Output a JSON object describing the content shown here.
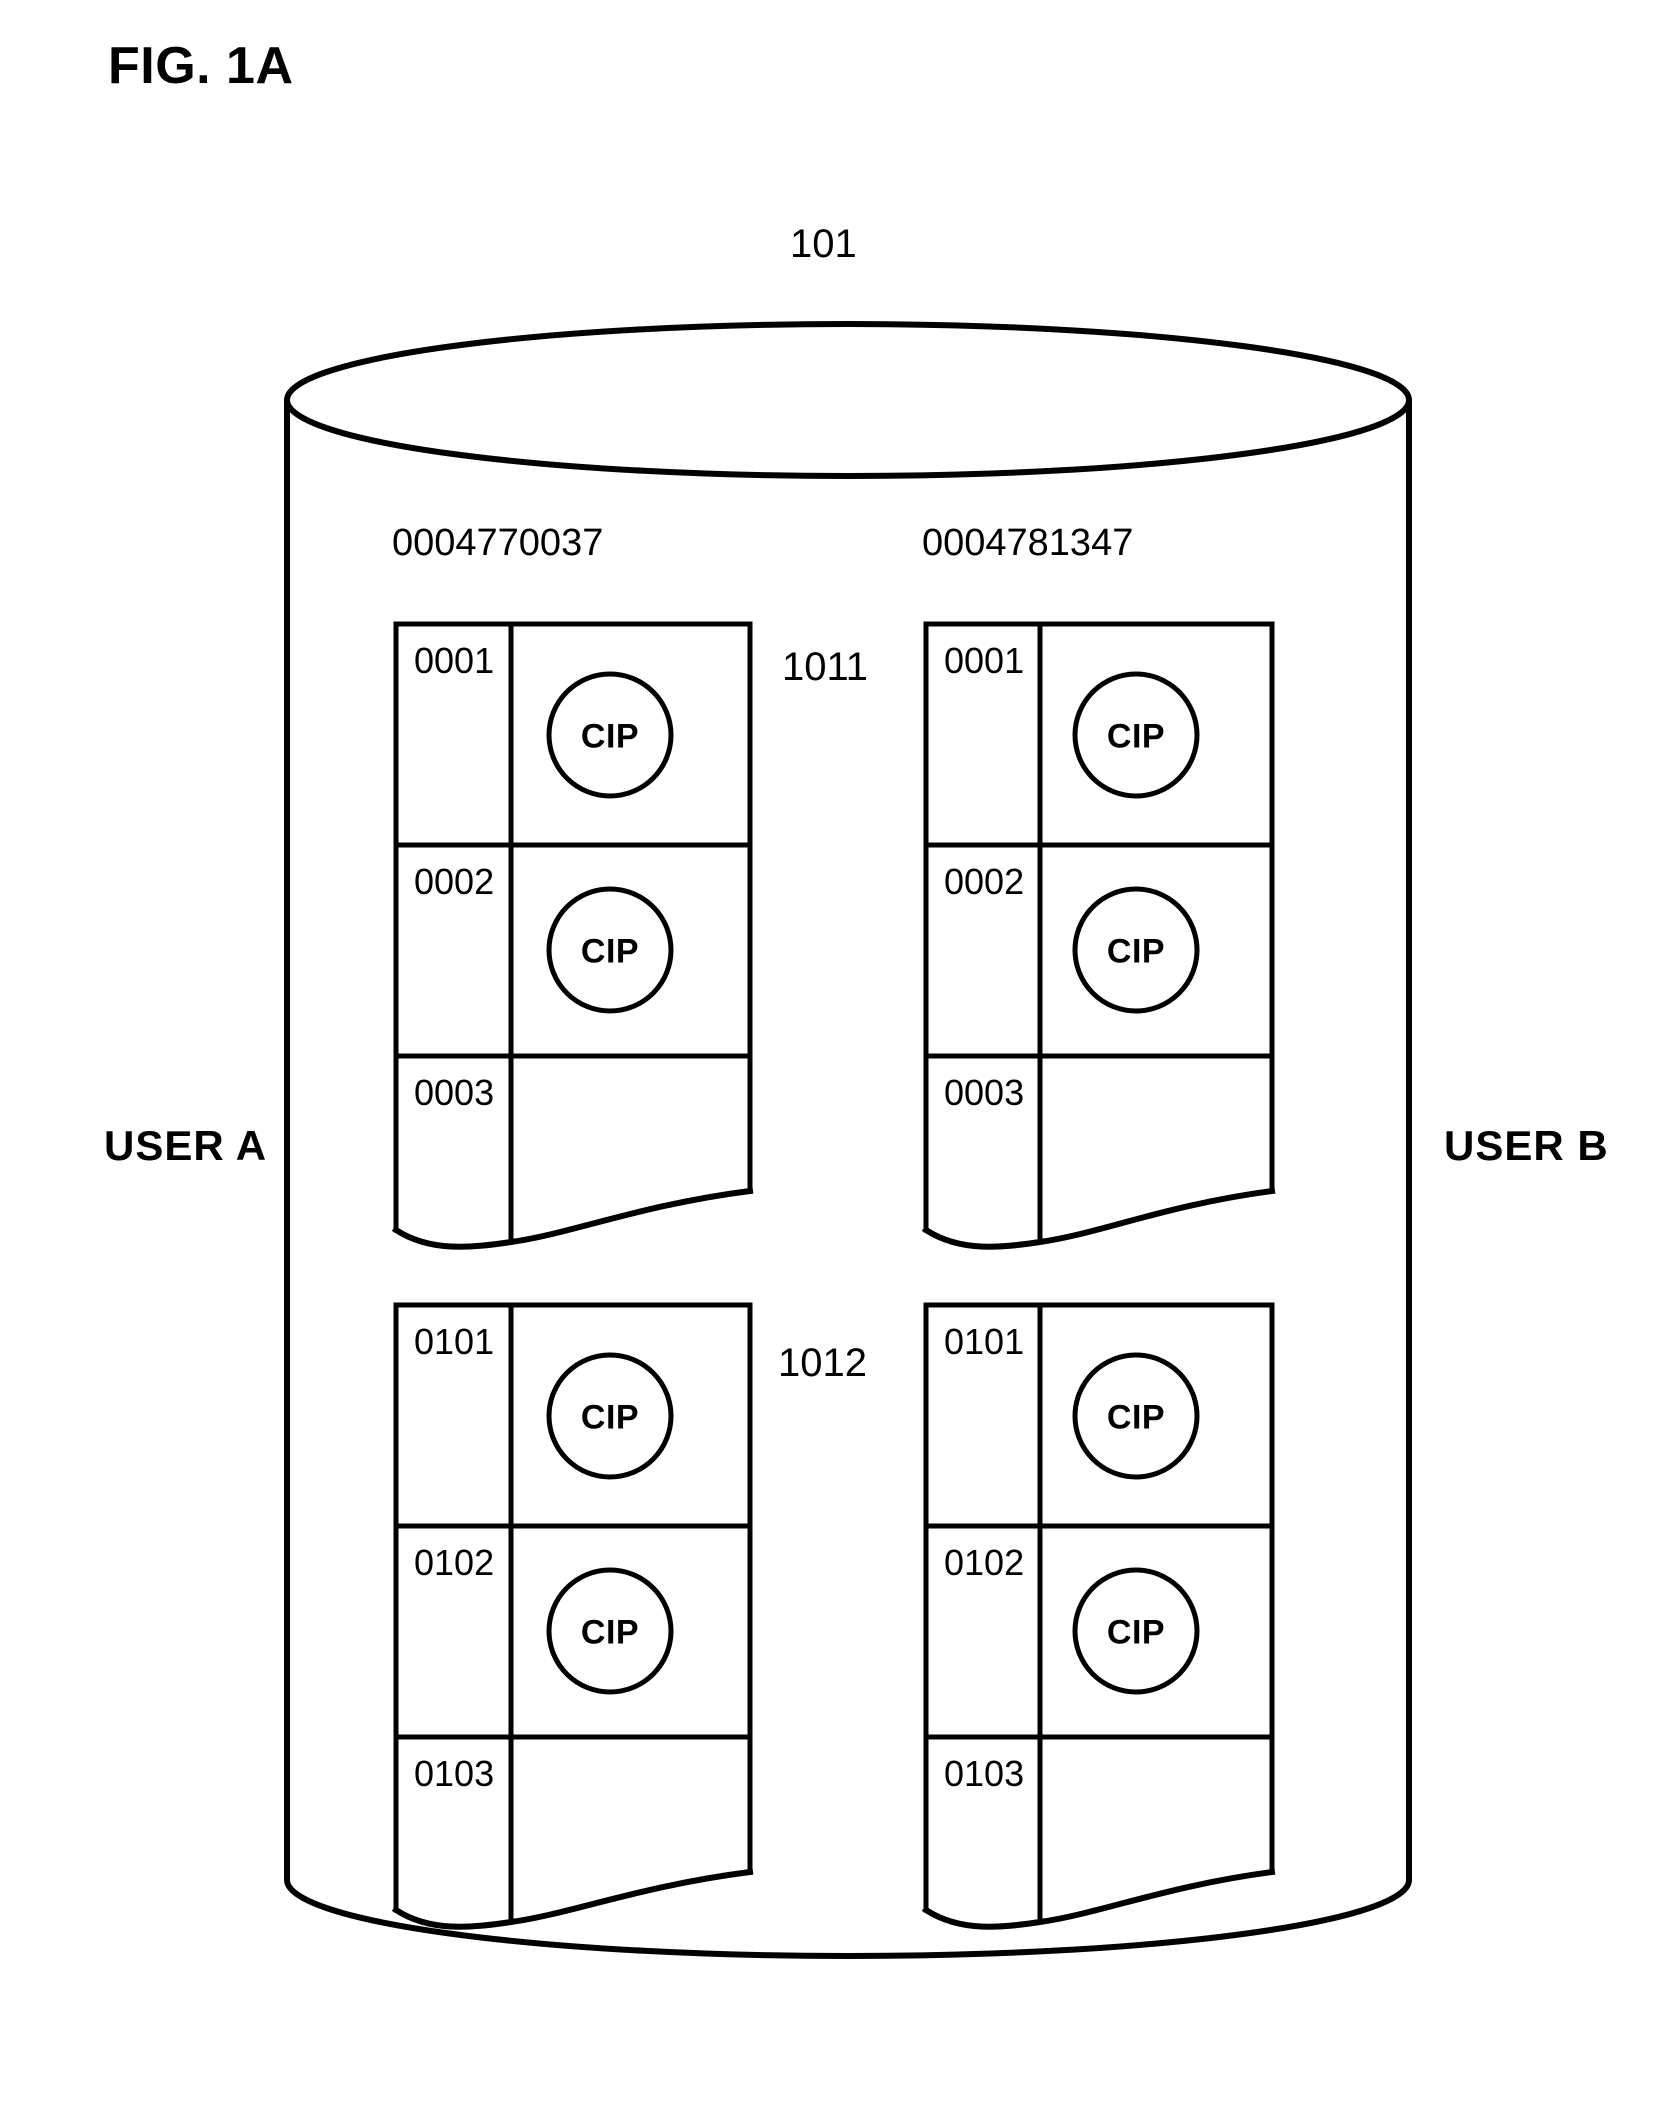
{
  "figure": {
    "title": "FIG. 1A",
    "storage_ref": "101",
    "storage_icon": "database-cylinder-icon"
  },
  "users": {
    "left_label": "USER A",
    "right_label": "USER B"
  },
  "columns": [
    {
      "header": "0004770037",
      "user": "USER A"
    },
    {
      "header": "0004781347",
      "user": "USER B"
    }
  ],
  "groups": [
    {
      "ref": "1011",
      "rows": [
        {
          "id": "0001",
          "content": "CIP"
        },
        {
          "id": "0002",
          "content": "CIP"
        },
        {
          "id": "0003",
          "content": ""
        }
      ]
    },
    {
      "ref": "1012",
      "rows": [
        {
          "id": "0101",
          "content": "CIP"
        },
        {
          "id": "0102",
          "content": "CIP"
        },
        {
          "id": "0103",
          "content": ""
        }
      ]
    }
  ],
  "tables": {
    "left_group1": {
      "rows": [
        {
          "id": "0001",
          "content": "CIP"
        },
        {
          "id": "0002",
          "content": "CIP"
        },
        {
          "id": "0003",
          "content": ""
        }
      ]
    },
    "right_group1": {
      "rows": [
        {
          "id": "0001",
          "content": "CIP"
        },
        {
          "id": "0002",
          "content": "CIP"
        },
        {
          "id": "0003",
          "content": ""
        }
      ]
    },
    "left_group2": {
      "rows": [
        {
          "id": "0101",
          "content": "CIP"
        },
        {
          "id": "0102",
          "content": "CIP"
        },
        {
          "id": "0103",
          "content": ""
        }
      ]
    },
    "right_group2": {
      "rows": [
        {
          "id": "0101",
          "content": "CIP"
        },
        {
          "id": "0102",
          "content": "CIP"
        },
        {
          "id": "0103",
          "content": ""
        }
      ]
    }
  },
  "colors": {
    "ink": "#000000",
    "paper": "#ffffff"
  }
}
